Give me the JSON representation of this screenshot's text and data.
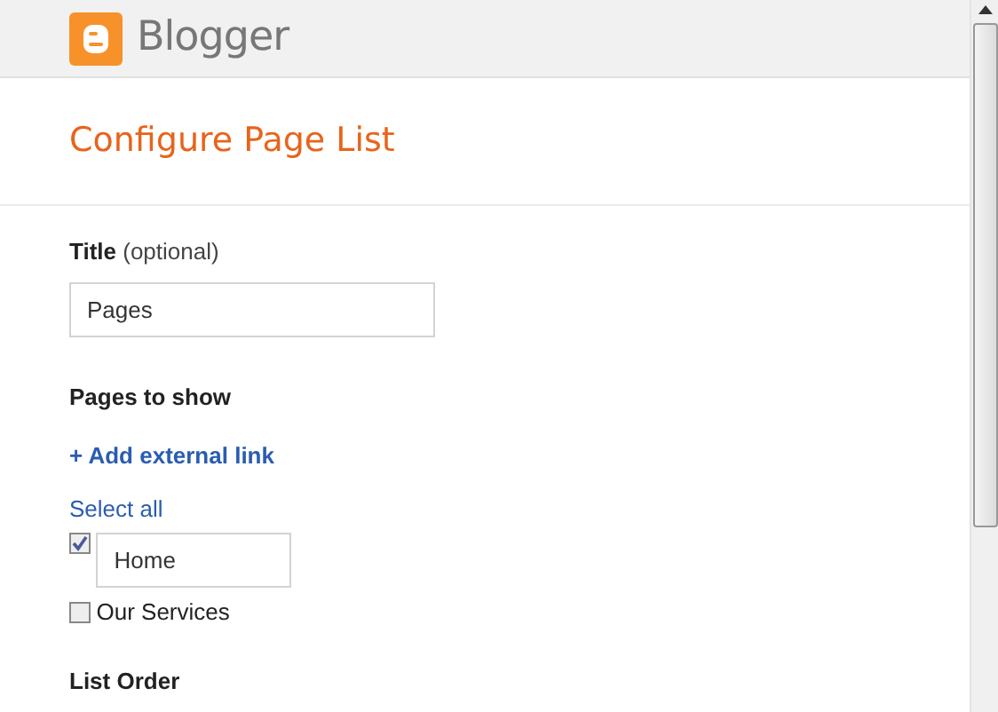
{
  "header": {
    "logo_text": "Blogger"
  },
  "heading": "Configure Page List",
  "title_field": {
    "label": "Title",
    "hint": "(optional)",
    "value": "Pages"
  },
  "pages_section": {
    "label": "Pages to show",
    "add_link": "+ Add external link",
    "select_all": "Select all",
    "pages": [
      {
        "kind": "editable",
        "label": "Home",
        "checked": true
      },
      {
        "kind": "plain",
        "label": "Our Services",
        "checked": false
      }
    ]
  },
  "next_section": {
    "label": "List Order"
  }
}
